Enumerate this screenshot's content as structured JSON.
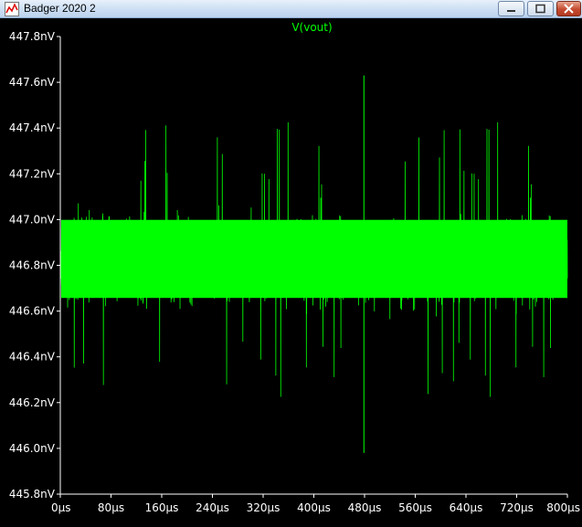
{
  "window": {
    "title": "Badger 2020 2",
    "icon": "ltspice-waveform-icon",
    "buttons": [
      "minimize",
      "maximize",
      "close"
    ]
  },
  "chart_data": {
    "type": "line",
    "title": "V(vout)",
    "xlabel": "",
    "ylabel": "",
    "x_unit": "µs",
    "y_unit": "nV",
    "xlim": [
      0,
      800
    ],
    "ylim": [
      445.8,
      447.8
    ],
    "x_ticks": [
      "0µs",
      "80µs",
      "160µs",
      "240µs",
      "320µs",
      "400µs",
      "480µs",
      "560µs",
      "640µs",
      "720µs",
      "800µs"
    ],
    "y_ticks": [
      "445.8nV",
      "446.0nV",
      "446.2nV",
      "446.4nV",
      "446.6nV",
      "446.8nV",
      "447.0nV",
      "447.2nV",
      "447.4nV",
      "447.6nV",
      "447.8nV"
    ],
    "series": [
      {
        "name": "V(vout)",
        "color": "#00ff00",
        "mean": 446.82,
        "band_low": 446.5,
        "band_high": 447.15,
        "min": 445.98,
        "max": 447.63,
        "max_at_x": 479,
        "min_at_x": 479
      }
    ],
    "background": "#000000",
    "grid": false
  }
}
